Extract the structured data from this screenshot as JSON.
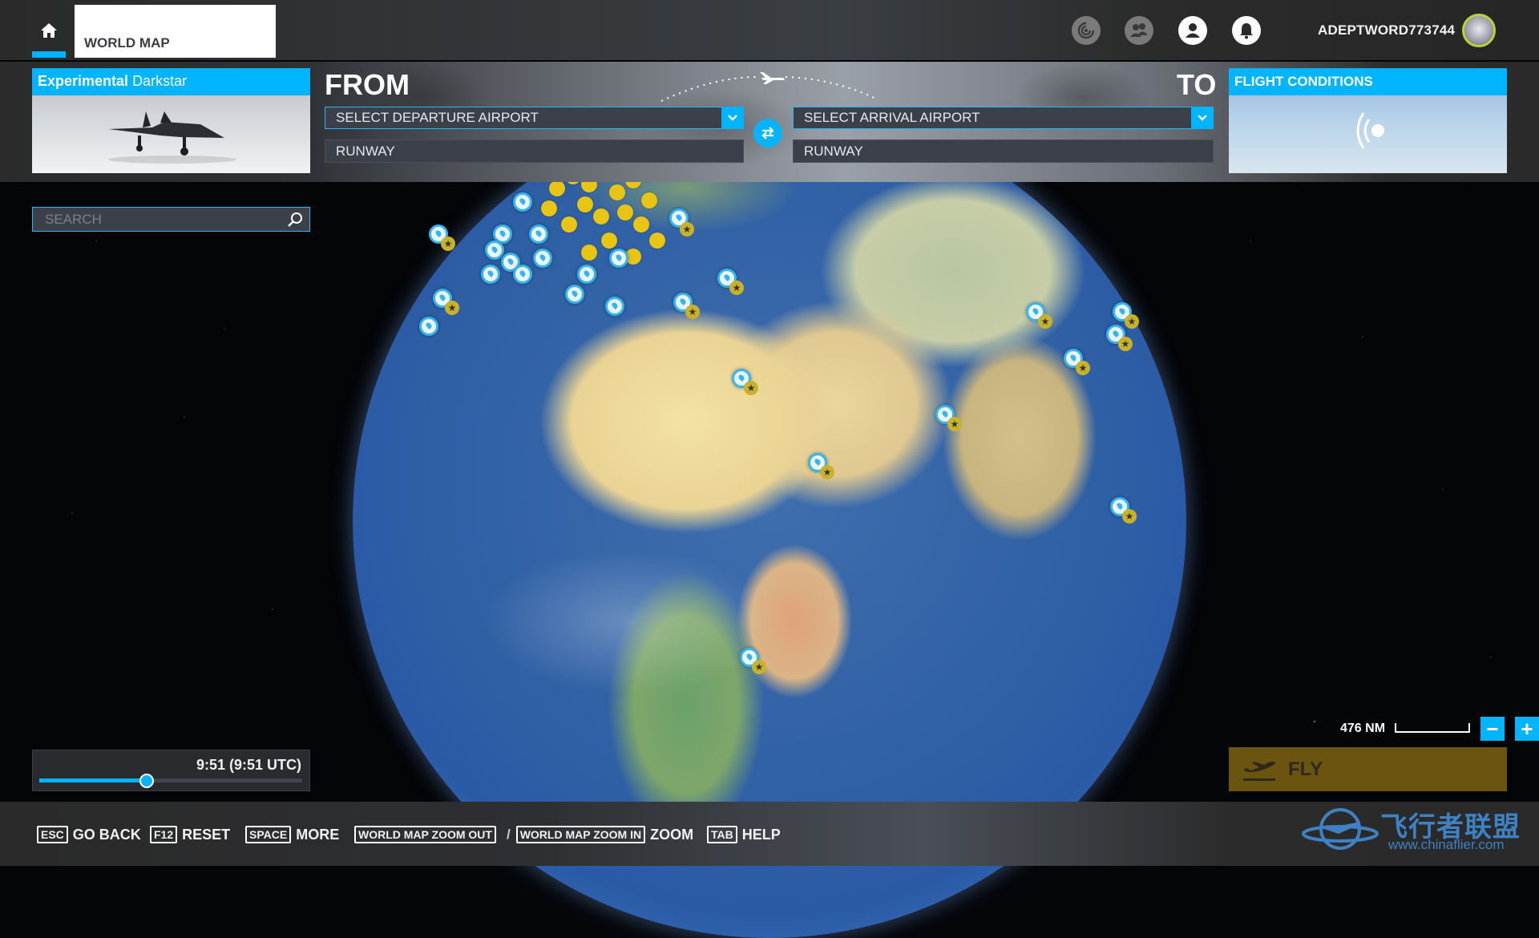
{
  "topbar": {
    "home_icon": "home-icon",
    "active_tab": "WORLD MAP",
    "icons": [
      "activity-icon",
      "friends-icon",
      "profile-icon",
      "notifications-icon"
    ],
    "username": "ADEPTWORD773744",
    "avatar_icon": "wolf-avatar"
  },
  "aircraft": {
    "category": "Experimental",
    "name": "Darkstar"
  },
  "flight_plan": {
    "from_label": "FROM",
    "to_label": "TO",
    "departure_placeholder": "SELECT DEPARTURE AIRPORT",
    "arrival_placeholder": "SELECT ARRIVAL AIRPORT",
    "departure_runway": "RUNWAY",
    "arrival_runway": "RUNWAY",
    "swap_icon": "swap-arrows-icon",
    "dropdown_icon": "chevron-down-icon"
  },
  "conditions": {
    "title": "FLIGHT CONDITIONS",
    "icon": "live-weather-icon"
  },
  "search": {
    "placeholder": "SEARCH",
    "value": ""
  },
  "time": {
    "display": "9:51 (9:51 UTC)",
    "slider_fraction": 0.41
  },
  "map": {
    "scale_label": "476 NM",
    "zoom_out": "−",
    "zoom_in": "+"
  },
  "fly": {
    "label": "FLY",
    "enabled": false
  },
  "hints": [
    {
      "key": "ESC",
      "label": "GO BACK"
    },
    {
      "key": "F12",
      "label": "RESET"
    },
    {
      "key": "SPACE",
      "label": "MORE"
    },
    {
      "key": "WORLD MAP ZOOM OUT",
      "key2": "WORLD MAP ZOOM IN",
      "separator": "/",
      "label": "ZOOM"
    },
    {
      "key": "TAB",
      "label": "HELP"
    }
  ],
  "watermark": {
    "title": "飞行者联盟",
    "url": "www.chinaflier.com"
  },
  "colors": {
    "accent": "#00b4ff",
    "fly_disabled": "#6b5310",
    "marker_blue": "#35b4ef",
    "marker_yellow": "#e8c514"
  }
}
